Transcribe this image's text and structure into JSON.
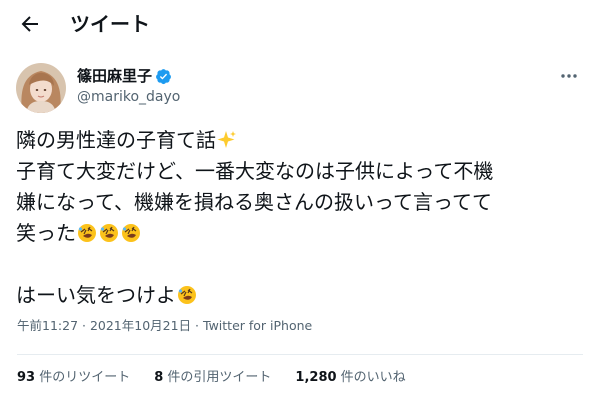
{
  "header": {
    "title": "ツイート"
  },
  "user": {
    "display_name": "篠田麻里子",
    "handle": "@mariko_dayo",
    "verified_color": "#1d9bf0"
  },
  "tweet": {
    "line1": "隣の男性達の子育て話",
    "line2": "子育て大変だけど、一番大変なのは子供によって不機",
    "line3": "嫌になって、機嫌を損ねる奥さんの扱いって言ってて",
    "line4": "笑った",
    "line6": "はーい気をつけよ",
    "emojis": [
      "sparkles-icon",
      "rolling-laughing-icon"
    ]
  },
  "meta": {
    "time": "午前11:27",
    "sep1": " · ",
    "date": "2021年10月21日",
    "sep2": " · ",
    "app": "Twitter for iPhone"
  },
  "stats": {
    "retweets_count": "93",
    "retweets_label": " 件のリツイート",
    "quotes_count": "8",
    "quotes_label": " 件の引用ツイート",
    "likes_count": "1,280",
    "likes_label": " 件のいいね"
  }
}
